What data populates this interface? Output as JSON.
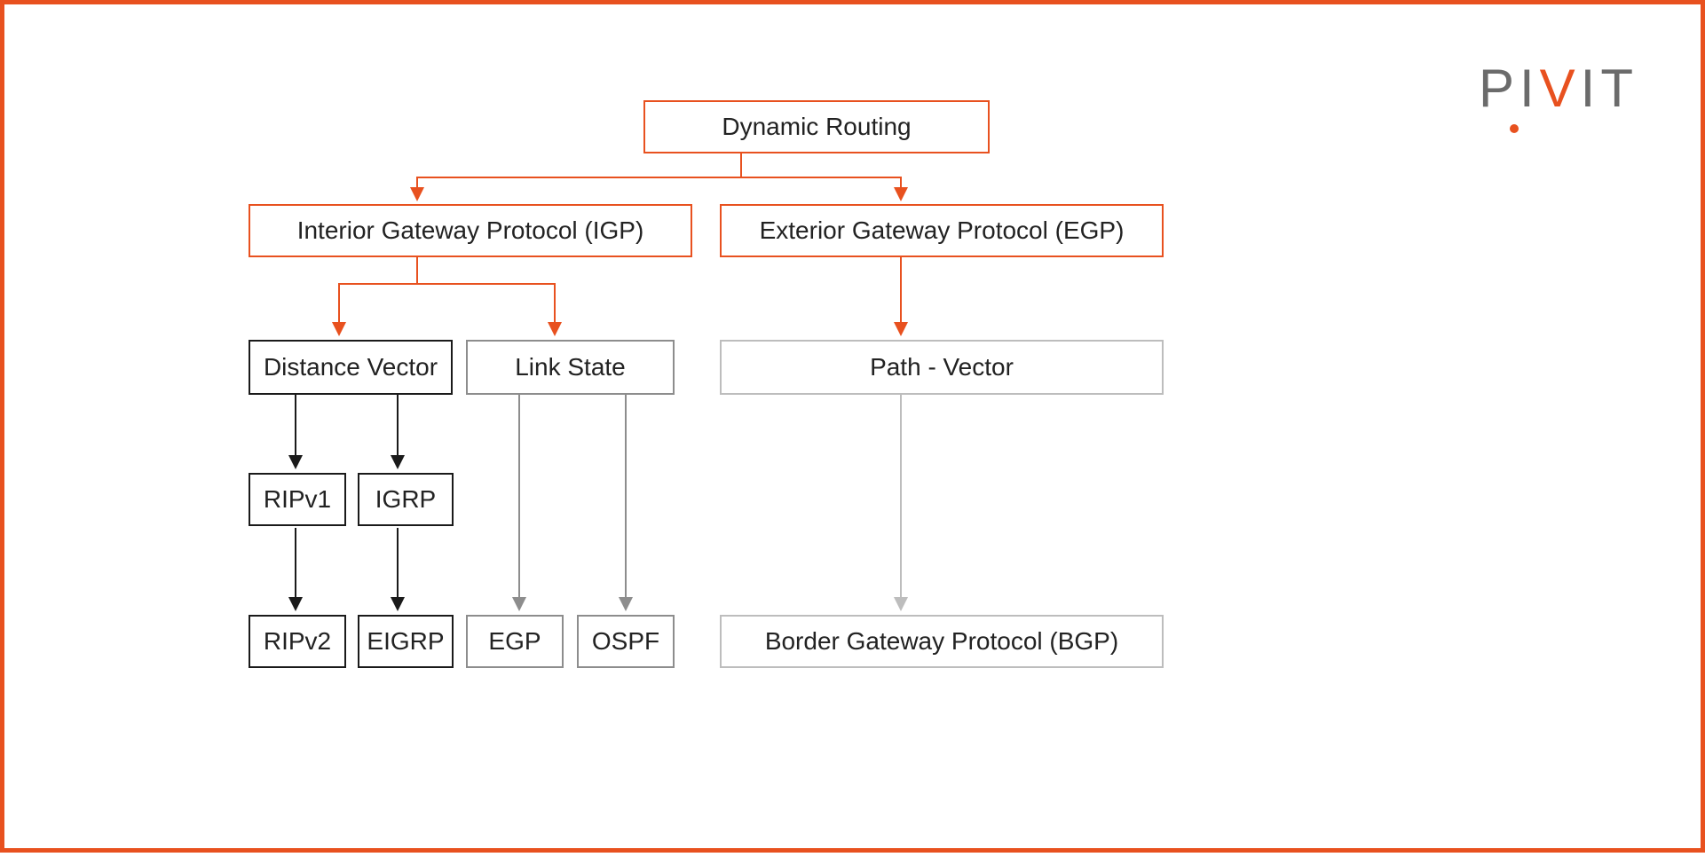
{
  "brand": "PIVIT",
  "nodes": {
    "root": "Dynamic Routing",
    "igp": "Interior Gateway Protocol (IGP)",
    "egp": "Exterior Gateway Protocol (EGP)",
    "dv": "Distance Vector",
    "ls": "Link State",
    "pv": "Path - Vector",
    "ripv1": "RIPv1",
    "igrp": "IGRP",
    "ripv2": "RIPv2",
    "eigrp": "EIGRP",
    "egp_leaf": "EGP",
    "ospf": "OSPF",
    "bgp": "Border Gateway Protocol (BGP)"
  },
  "edges": [
    [
      "root",
      "igp"
    ],
    [
      "root",
      "egp"
    ],
    [
      "igp",
      "dv"
    ],
    [
      "igp",
      "ls"
    ],
    [
      "egp",
      "pv"
    ],
    [
      "dv",
      "ripv1"
    ],
    [
      "dv",
      "igrp"
    ],
    [
      "ripv1",
      "ripv2"
    ],
    [
      "igrp",
      "eigrp"
    ],
    [
      "ls",
      "egp_leaf"
    ],
    [
      "ls",
      "ospf"
    ],
    [
      "pv",
      "bgp"
    ]
  ],
  "colors": {
    "orange": "#e8511f",
    "black": "#1a1a1a",
    "gray": "#8d8d8d",
    "light": "#bdbdbd"
  }
}
